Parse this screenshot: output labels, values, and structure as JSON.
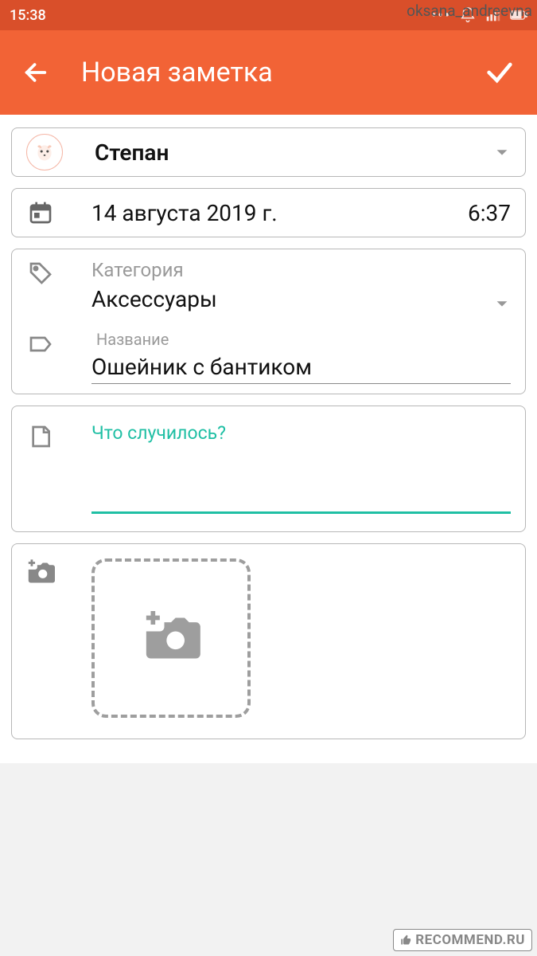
{
  "statusbar": {
    "time": "15:38",
    "watermark": "oksana_andreevna"
  },
  "appbar": {
    "title": "Новая заметка"
  },
  "pet": {
    "name": "Степан"
  },
  "date": {
    "value": "14 августа 2019 г.",
    "time": "6:37"
  },
  "category": {
    "label": "Категория",
    "value": "Аксессуары"
  },
  "name": {
    "label": "Название",
    "value": "Ошейник с бантиком"
  },
  "note": {
    "placeholder": "Что случилось?"
  },
  "watermark": {
    "text": "RECOMMEND.RU"
  }
}
